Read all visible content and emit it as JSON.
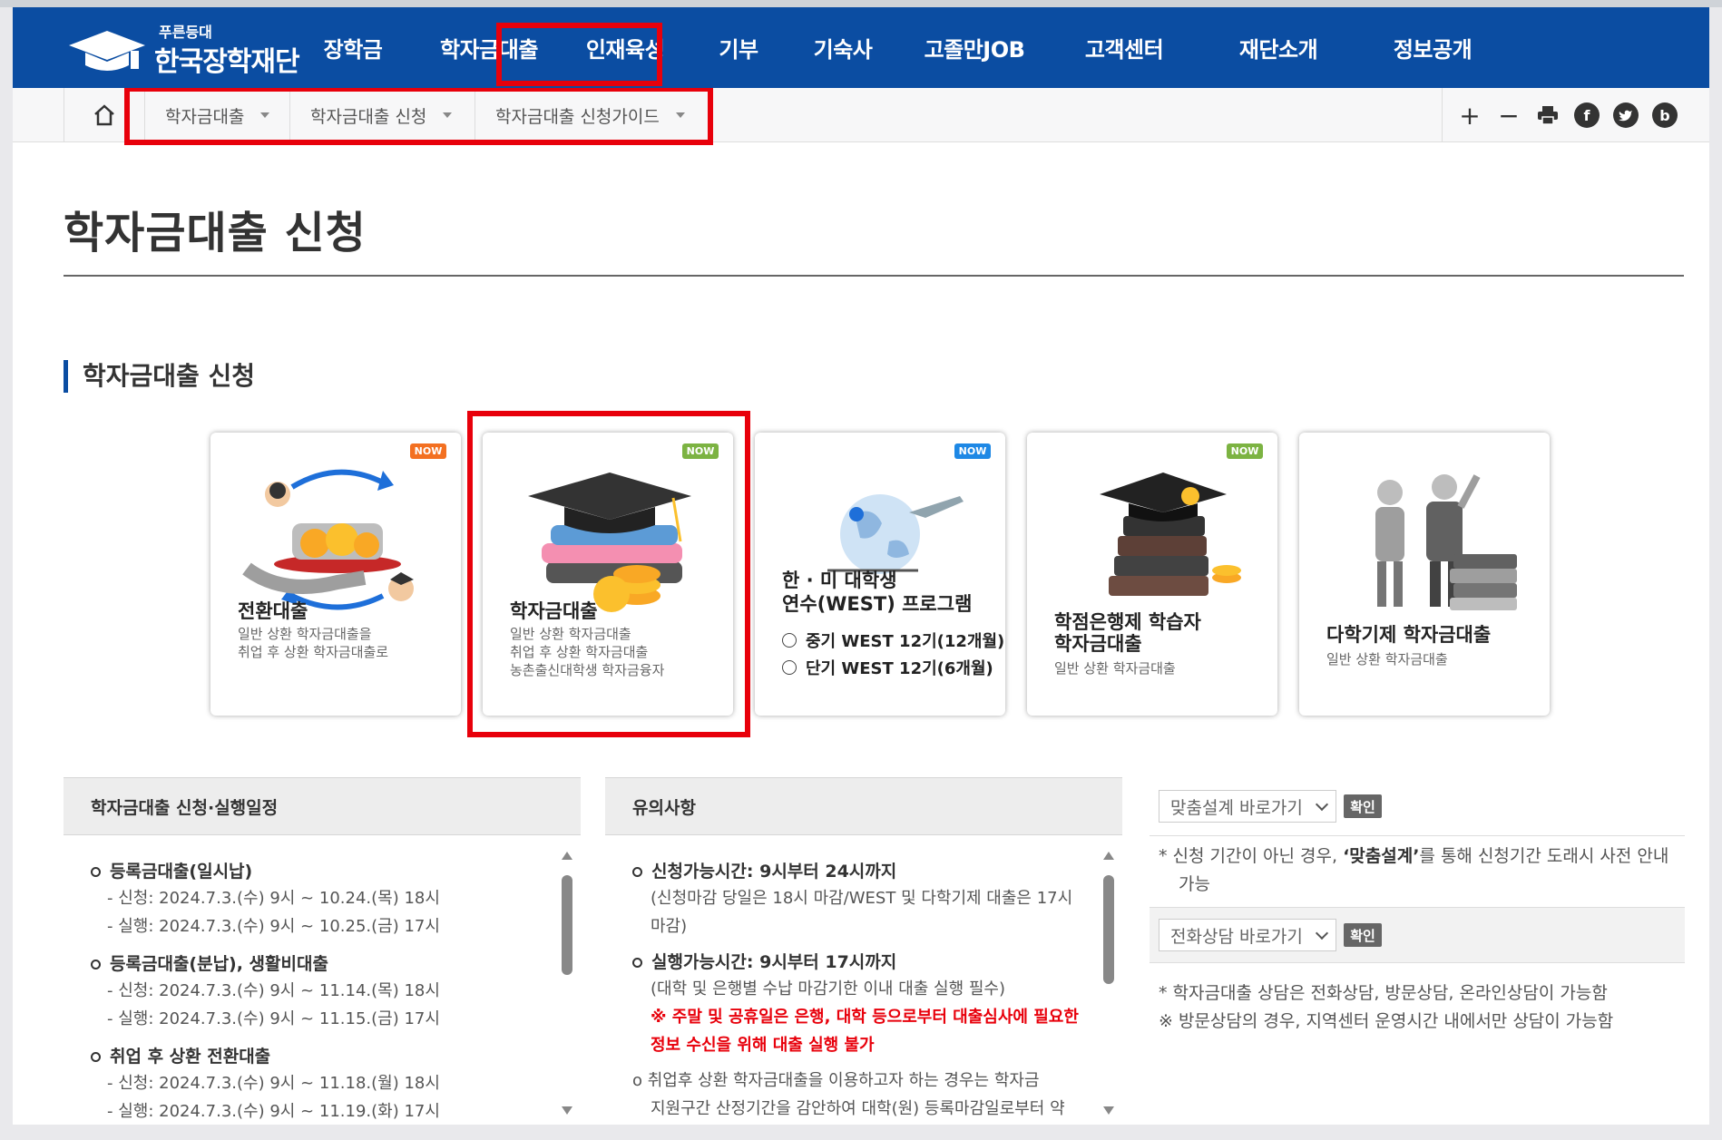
{
  "header": {
    "logo_sub": "푸른등대",
    "logo_name": "한국장학재단",
    "nav": [
      "장학금",
      "학자금대출",
      "인재육성",
      "기부",
      "기숙사",
      "고졸만JOB",
      "고객센터",
      "재단소개",
      "정보공개"
    ]
  },
  "breadcrumb": {
    "items": [
      "학자금대출",
      "학자금대출 신청",
      "학자금대출 신청가이드"
    ]
  },
  "tools": {
    "plus": "+",
    "minus": "−",
    "facebook": "f",
    "blog": "b"
  },
  "page_title": "학자금대출 신청",
  "section_title": "학자금대출 신청",
  "cards": [
    {
      "badge": "NOW",
      "badge_color": "#f37021",
      "title": "전환대출",
      "desc": [
        "일반 상환 학자금대출을",
        "취업 후 상환 학자금대출로"
      ]
    },
    {
      "badge": "NOW",
      "badge_color": "#7cb342",
      "title": "학자금대출",
      "desc": [
        "일반 상환 학자금대출",
        "취업 후 상환 학자금대출",
        "농촌출신대학생 학자금융자"
      ]
    },
    {
      "badge": "NOW",
      "badge_color": "#1e88e5",
      "title": [
        "한 · 미 대학생",
        "연수(WEST) 프로그램"
      ],
      "options": [
        "중기 WEST 12기(12개월)",
        "단기 WEST 12기(6개월)"
      ]
    },
    {
      "badge": "NOW",
      "badge_color": "#7cb342",
      "title": [
        "학점은행제 학습자",
        "학자금대출"
      ],
      "desc": [
        "일반 상환 학자금대출"
      ]
    },
    {
      "title": "다학기제 학자금대출",
      "desc": [
        "일반 상환 학자금대출"
      ]
    }
  ],
  "schedule": {
    "header": "학자금대출 신청·실행일정",
    "items": [
      {
        "title": "등록금대출(일시납)",
        "lines": [
          "- 신청: 2024.7.3.(수) 9시 ~ 10.24.(목) 18시",
          "- 실행: 2024.7.3.(수) 9시 ~ 10.25.(금) 17시"
        ]
      },
      {
        "title": "등록금대출(분납), 생활비대출",
        "lines": [
          "- 신청: 2024.7.3.(수) 9시 ~ 11.14.(목) 18시",
          "- 실행: 2024.7.3.(수) 9시 ~ 11.15.(금) 17시"
        ]
      },
      {
        "title": "취업 후 상환 전환대출",
        "lines": [
          "- 신청: 2024.7.3.(수) 9시 ~ 11.18.(월) 18시",
          "- 실행: 2024.7.3.(수) 9시 ~ 11.19.(화) 17시"
        ]
      }
    ]
  },
  "notice": {
    "header": "유의사항",
    "item1_title": "신청가능시간: 9시부터 24시까지",
    "item1_text": [
      "(신청마감 당일은 18시 마감/WEST 및 다학기제 대출은 17시",
      "마감)"
    ],
    "item2_title": "실행가능시간: 9시부터 17시까지",
    "item2_text": "(대학 및 은행별 수납 마감기한 이내 대출 실행 필수)",
    "item2_warn": [
      "※ 주말 및 공휴일은 은행, 대학 등으로부터 대출심사에 필요한",
      "정보 수신을 위해 대출 실행 불가"
    ],
    "item3_text": [
      "o 취업후 상환 학자금대출을 이용하고자 하는 경우는 학자금",
      "지원구간 산정기간을 감안하여 대학(원) 등록마감일로부터 약"
    ]
  },
  "shortcuts": {
    "select1": "맞춤설계 바로가기",
    "confirm": "확인",
    "note1_prefix": "*  신청 기간이 아닌 경우, ",
    "note1_bold": "‘맞춤설계’",
    "note1_suffix": "를 통해 신청기간 도래시 사전 안내",
    "note1_line2": "가능",
    "select2": "전화상담 바로가기",
    "note2": "* 학자금대출 상담은 전화상담, 방문상담, 온라인상담이 가능함",
    "note3": "※ 방문상담의 경우, 지역센터 운영시간 내에서만 상담이 가능함"
  },
  "colors": {
    "brand": "#0b4da2",
    "highlight": "#e8000b"
  }
}
